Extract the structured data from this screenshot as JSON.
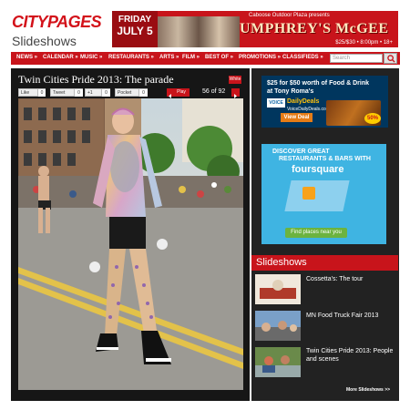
{
  "header": {
    "logo": "CITYPAGES",
    "section": "Slideshows"
  },
  "ad_banner": {
    "day": "FRIDAY",
    "date": "JULY 5",
    "presents": "Caboose Outdoor Plaza presents",
    "title": "UMPHREY'S McGEE",
    "price": "$25/$30 • 8:00pm • 18+"
  },
  "nav": {
    "items": [
      "NEWS »",
      "CALENDAR »",
      "MUSIC »",
      "RESTAURANTS »",
      "ARTS »",
      "FILM »",
      "BEST OF »",
      "PROMOTIONS »",
      "CLASSIFIEDS »"
    ],
    "search_placeholder": "Search"
  },
  "slideshow": {
    "title": "Twin Cities Pride 2013: The parade",
    "white_label": "White",
    "play_label": "Play",
    "counter": "56 of 92",
    "social": [
      {
        "label": "Like",
        "count": "0"
      },
      {
        "label": "Tweet",
        "count": "0"
      },
      {
        "label": "+1",
        "count": "0"
      },
      {
        "label": "Pocket",
        "count": "0"
      }
    ]
  },
  "sidebar": {
    "deal_ad": {
      "line1": "$25 for $50 worth of Food & Drink",
      "line2": "at Tony Roma's",
      "voice": "VOICE",
      "deals": "DailyDeals",
      "site": "VoiceDailyDeals.com",
      "view": "View Deal",
      "off": "50%"
    },
    "foursquare_ad": {
      "line1": "DISCOVER GREAT",
      "line2": "RESTAURANTS & BARS WITH",
      "brand": "foursquare",
      "button": "Find places near you"
    },
    "slideshows_header": "Slideshows",
    "slideshows": [
      {
        "title": "Cossetta's: The tour"
      },
      {
        "title": "MN Food Truck Fair 2013"
      },
      {
        "title": "Twin Cities Pride 2013: People and scenes"
      }
    ],
    "more": "More Slideshows >>"
  },
  "colors": {
    "brand_red": "#c8141b",
    "panel_dark": "#161616"
  }
}
